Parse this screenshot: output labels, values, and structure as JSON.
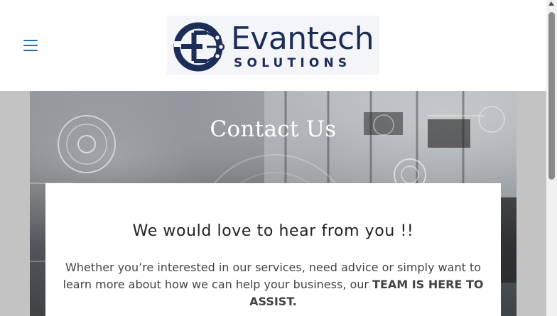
{
  "header": {
    "menu_icon": "hamburger-menu-icon",
    "logo": {
      "word": "Evantech",
      "sub": "SOLUTIONS",
      "colors": {
        "navy": "#1c2d58",
        "accent": "#1b6fae"
      }
    }
  },
  "hero": {
    "title": "Contact Us"
  },
  "card": {
    "heading": "We would love to hear from you !!",
    "text_lead": "Whether you’re interested in our services, need advice or simply want to learn more about how we can help your business, our ",
    "text_strong": "TEAM IS HERE TO ASSIST."
  }
}
